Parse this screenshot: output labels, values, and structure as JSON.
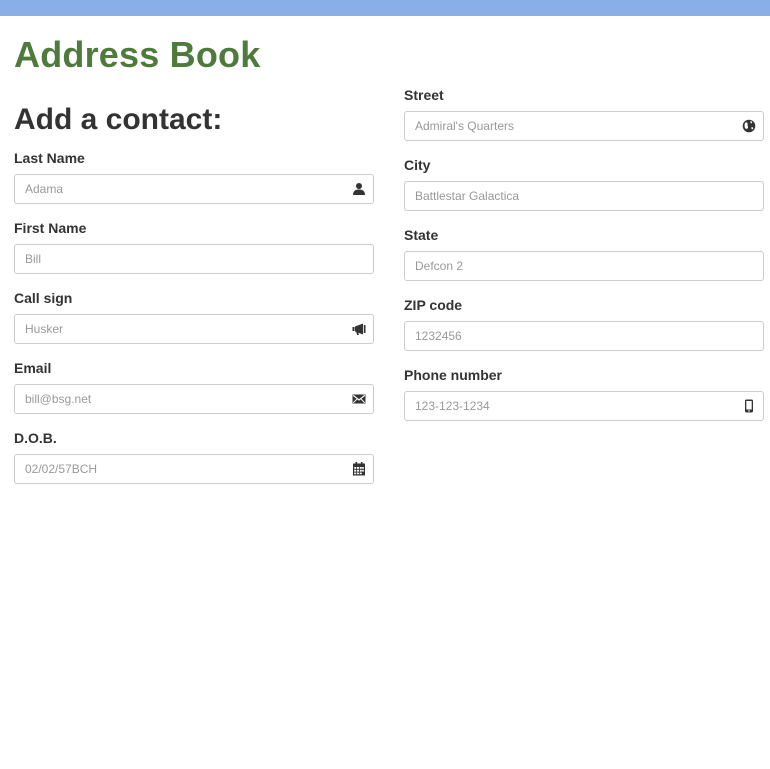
{
  "header": {
    "app_title": "Address Book",
    "section_title": "Add a contact:",
    "bar_color": "#8aaee8",
    "title_color": "#4e7a3c"
  },
  "form": {
    "left": [
      {
        "label": "Last Name",
        "placeholder": "Adama",
        "icon": "user-icon"
      },
      {
        "label": "First Name",
        "placeholder": "Bill",
        "icon": ""
      },
      {
        "label": "Call sign",
        "placeholder": "Husker",
        "icon": "megaphone-icon"
      },
      {
        "label": "Email",
        "placeholder": "bill@bsg.net",
        "icon": "envelope-icon"
      },
      {
        "label": "D.O.B.",
        "placeholder": "02/02/57BCH",
        "icon": "calendar-icon"
      }
    ],
    "right": [
      {
        "label": "Street",
        "placeholder": "Admiral's Quarters",
        "icon": "globe-icon"
      },
      {
        "label": "City",
        "placeholder": "Battlestar Galactica",
        "icon": ""
      },
      {
        "label": "State",
        "placeholder": "Defcon 2",
        "icon": ""
      },
      {
        "label": "ZIP code",
        "placeholder": "1232456",
        "icon": ""
      },
      {
        "label": "Phone number",
        "placeholder": "123-123-1234",
        "icon": "phone-icon"
      }
    ]
  }
}
